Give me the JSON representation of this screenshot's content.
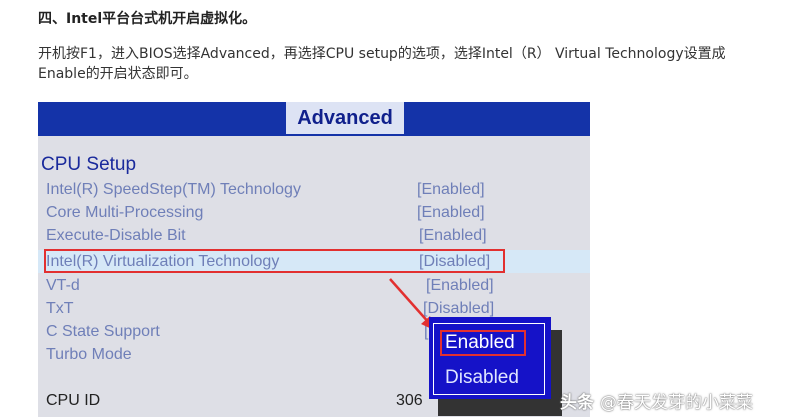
{
  "article": {
    "heading": "四、Intel平台台式机开启虚拟化。",
    "paragraph": "开机按F1，进入BIOS选择Advanced，再选择CPU setup的选项，选择Intel（R） Virtual Technology设置成Enable的开启状态即可。"
  },
  "bios": {
    "tab": "Advanced",
    "section_title": "CPU Setup",
    "rows": [
      {
        "label": "Intel(R) SpeedStep(TM) Technology",
        "value": "[Enabled]"
      },
      {
        "label": "Core Multi-Processing",
        "value": "[Enabled]"
      },
      {
        "label": "Execute-Disable Bit",
        "value": "[Enabled]"
      },
      {
        "label": "Intel(R) Virtualization Technology",
        "value": "[Disabled]"
      },
      {
        "label": "VT-d",
        "value": "[Enabled]"
      },
      {
        "label": "TxT",
        "value": "[Disabled]"
      },
      {
        "label": "C State Support",
        "value": "["
      },
      {
        "label": "Turbo Mode",
        "value": ""
      }
    ],
    "popup": {
      "options": [
        "Enabled",
        "Disabled"
      ],
      "selected": "Enabled"
    },
    "cpuid": {
      "label": "CPU ID",
      "value": "306"
    },
    "colors": {
      "topbar": "#1433a8",
      "tab_bg": "#dde3f4",
      "panel_bg": "#dedfe6",
      "label_text": "#6f7fb8",
      "highlight_row": "#d6e8f7",
      "popup_bg": "#1512c8",
      "annotation_red": "#e23030"
    }
  },
  "watermark": {
    "logo": "头条",
    "text": "@春天发芽的小菜菜"
  }
}
